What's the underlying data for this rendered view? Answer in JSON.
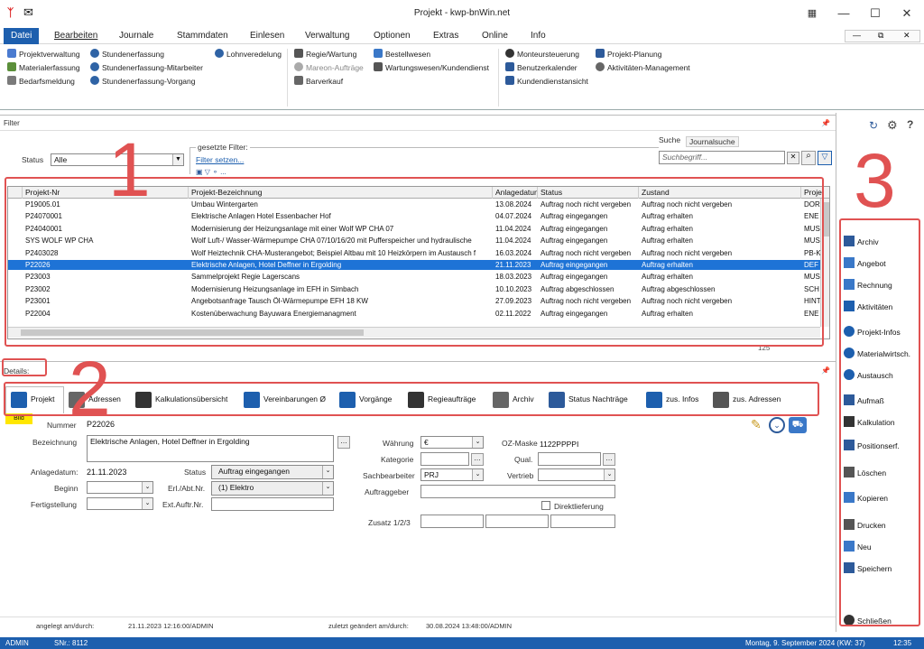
{
  "window": {
    "title": "Projekt - kwp-bnWin.net",
    "minimize": "—",
    "maximize": "☐",
    "close": "✕",
    "mdi_min": "—",
    "mdi_restore": "⧉",
    "mdi_close": "✕"
  },
  "menu": [
    "Datei",
    "Bearbeiten",
    "Journale",
    "Stammdaten",
    "Einlesen",
    "Verwaltung",
    "Optionen",
    "Extras",
    "Online",
    "Info"
  ],
  "ribbon": {
    "col1": [
      "Projektverwaltung",
      "Materialerfassung",
      "Bedarfsmeldung"
    ],
    "col2": [
      "Stundenerfassung",
      "Stundenerfassung-Mitarbeiter",
      "Stundenerfassung-Vorgang"
    ],
    "col3": [
      "Lohnveredelung"
    ],
    "col4": [
      "Regie/Wartung",
      "Mareon-Aufträge",
      "Barverkauf"
    ],
    "col5": [
      "Bestellwesen",
      "Wartungswesen/Kundendienst"
    ],
    "col6": [
      "Monteursteuerung",
      "Benutzerkalender",
      "Kundendienstansicht"
    ],
    "col7": [
      "Projekt-Planung",
      "Aktivitäten-Management"
    ]
  },
  "filter": {
    "title": "Filter",
    "status_label": "Status",
    "status_value": "Alle",
    "gesetzte_filter": "gesetzte Filter:",
    "filter_setzen": "Filter setzen...",
    "search_tab": "Suche",
    "journal_tab": "Journalsuche",
    "search_placeholder": "Suchbegriff..."
  },
  "grid": {
    "columns": [
      "Projekt-Nr",
      "Projekt-Bezeichnung",
      "Anlagedatum",
      "Status",
      "Zustand",
      "Proje"
    ],
    "rows": [
      [
        "P19005.01",
        "Umbau Wintergarten",
        "13.08.2024",
        "Auftrag noch nicht vergeben",
        "Auftrag noch nicht vergeben",
        "DOR"
      ],
      [
        "P24070001",
        "Elektrische Anlagen Hotel Essenbacher Hof",
        "04.07.2024",
        "Auftrag eingegangen",
        "Auftrag erhalten",
        "ENE"
      ],
      [
        "P24040001",
        "Modernisierung der Heizungsanlage mit einer Wolf WP CHA 07",
        "11.04.2024",
        "Auftrag eingegangen",
        "Auftrag erhalten",
        "MUS"
      ],
      [
        "SYS WOLF WP CHA",
        "Wolf Luft-/ Wasser-Wärmepumpe CHA 07/10/16/20 mit Pufferspeicher und hydraulische",
        "11.04.2024",
        "Auftrag eingegangen",
        "Auftrag erhalten",
        "MUS"
      ],
      [
        "P2403028",
        "Wolf Heiztechnik CHA-Musterangebot; Beispiel Altbau mit 10 Heizkörpern im Austausch f",
        "16.03.2024",
        "Auftrag noch nicht vergeben",
        "Auftrag noch nicht vergeben",
        "PB-K"
      ],
      [
        "P22026",
        "Elektrische Anlagen, Hotel Deffner in Ergolding",
        "21.11.2023",
        "Auftrag eingegangen",
        "Auftrag erhalten",
        "DEF"
      ],
      [
        "P23003",
        "Sammelprojekt Regie Lagerscans",
        "18.03.2023",
        "Auftrag eingegangen",
        "Auftrag erhalten",
        "MUS"
      ],
      [
        "P23002",
        "Modernisierung Heizungsanlage im EFH in Simbach",
        "10.10.2023",
        "Auftrag abgeschlossen",
        "Auftrag abgeschlossen",
        "SCH"
      ],
      [
        "P23001",
        "Angebotsanfrage Tausch Öl-Wärmepumpe EFH 18 KW",
        "27.09.2023",
        "Auftrag noch nicht vergeben",
        "Auftrag noch nicht vergeben",
        "HINT"
      ],
      [
        "P22004",
        "Kostenüberwachung Bayuwara Energiemanagment",
        "02.11.2022",
        "Auftrag eingegangen",
        "Auftrag erhalten",
        "ENE"
      ]
    ],
    "count": "125"
  },
  "details": {
    "label": "Details:",
    "tabs": [
      "Projekt",
      "Adressen",
      "Kalkulationsübersicht",
      "Vereinbarungen Ø",
      "Vorgänge",
      "Regieaufträge",
      "Archiv",
      "Status Nachträge",
      "zus. Infos",
      "zus. Adressen"
    ]
  },
  "form": {
    "nummer_label": "Nummer",
    "nummer_value": "P22026",
    "bezeichnung_label": "Bezeichnung",
    "bezeichnung_value": "Elektrische Anlagen, Hotel Deffner in Ergolding",
    "anlagedatum_label": "Anlagedatum:",
    "anlagedatum_value": "21.11.2023",
    "status_label": "Status",
    "status_value": "Auftrag eingegangen",
    "beginn_label": "Beginn",
    "erl_label": "Erl./Abt.Nr.",
    "erl_value": "(1) Elektro",
    "fertigstellung_label": "Fertigstellung",
    "ext_label": "Ext.Auftr.Nr.",
    "waehrung_label": "Währung",
    "waehrung_value": "€",
    "ozmaske_label": "OZ-Maske",
    "ozmaske_value": "1122PPPPI",
    "kategorie_label": "Kategorie",
    "qual_label": "Qual.",
    "sachbearbeiter_label": "Sachbearbeiter",
    "sachbearbeiter_value": "PRJ",
    "vertrieb_label": "Vertrieb",
    "auftraggeber_label": "Auftraggeber",
    "direktlieferung_label": "Direktlieferung",
    "zusatz_label": "Zusatz 1/2/3",
    "angelegt_label": "angelegt am/durch:",
    "angelegt_value": "21.11.2023 12:16:00/ADMIN",
    "geaendert_label": "zuletzt geändert am/durch:",
    "geaendert_value": "30.08.2024 13:48:00/ADMIN",
    "badge": "Bild"
  },
  "actions": [
    "Archiv",
    "Angebot",
    "Rechnung",
    "Aktivitäten",
    "Projekt-Infos",
    "Materialwirtsch.",
    "Austausch",
    "Aufmaß",
    "Kalkulation",
    "Positionserf.",
    "Löschen",
    "Kopieren",
    "Drucken",
    "Neu",
    "Speichern",
    "Schließen"
  ],
  "status": {
    "user": "ADMIN",
    "snr": "SNr.: 8112",
    "date": "Montag, 9. September 2024  (KW: 37)",
    "time": "12:35"
  },
  "annotations": [
    "1",
    "2",
    "3"
  ],
  "colors": {
    "accent": "#1d5fae",
    "selection": "#1e73d6",
    "annotation": "#e05252"
  }
}
